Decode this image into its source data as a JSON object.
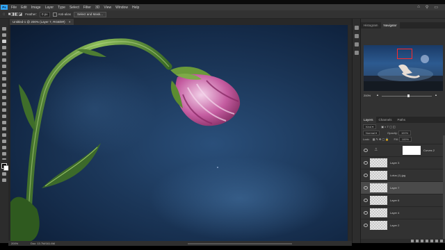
{
  "menubar": {
    "logo": "Ps",
    "items": [
      "File",
      "Edit",
      "Image",
      "Layer",
      "Type",
      "Select",
      "Filter",
      "3D",
      "View",
      "Window",
      "Help"
    ]
  },
  "options": {
    "feather_label": "Feather:",
    "feather_value": "0 px",
    "antialias_label": "Anti-alias",
    "select_mask_button": "Select and Mask..."
  },
  "document": {
    "tab_title": "Untitled-1 @ 200% (Layer 7, RGB/8#)",
    "close_glyph": "×"
  },
  "status": {
    "zoom": "200%",
    "doc_size": "Doc: 13.7M/161.6M"
  },
  "navigator": {
    "tabs": [
      "Histogram",
      "Navigator"
    ],
    "zoom": "200%"
  },
  "layers_panel": {
    "tabs": [
      "Layers",
      "Channels",
      "Paths"
    ],
    "kind_label": "Kind",
    "blend_mode": "Normal",
    "opacity_label": "Opacity:",
    "opacity_value": "100%",
    "lock_label": "Lock:",
    "fill_label": "Fill:",
    "fill_value": "100%",
    "layers": [
      {
        "name": "Curves 2",
        "selected": false,
        "thumb": "white"
      },
      {
        "name": "Layer 3",
        "selected": false,
        "thumb": "checker"
      },
      {
        "name": "Lotus (1).jpg",
        "selected": false,
        "thumb": "checker"
      },
      {
        "name": "Layer 7",
        "selected": true,
        "thumb": "checker"
      },
      {
        "name": "Layer 6",
        "selected": false,
        "thumb": "checker"
      },
      {
        "name": "Layer 4",
        "selected": false,
        "thumb": "checker"
      },
      {
        "name": "Layer 2",
        "selected": false,
        "thumb": "checker"
      }
    ]
  },
  "colors": {
    "app_bg": "#323232",
    "canvas_bg": "#1b3658",
    "accent": "#31a8ff",
    "nav_view_box": "#ff2a2a"
  }
}
